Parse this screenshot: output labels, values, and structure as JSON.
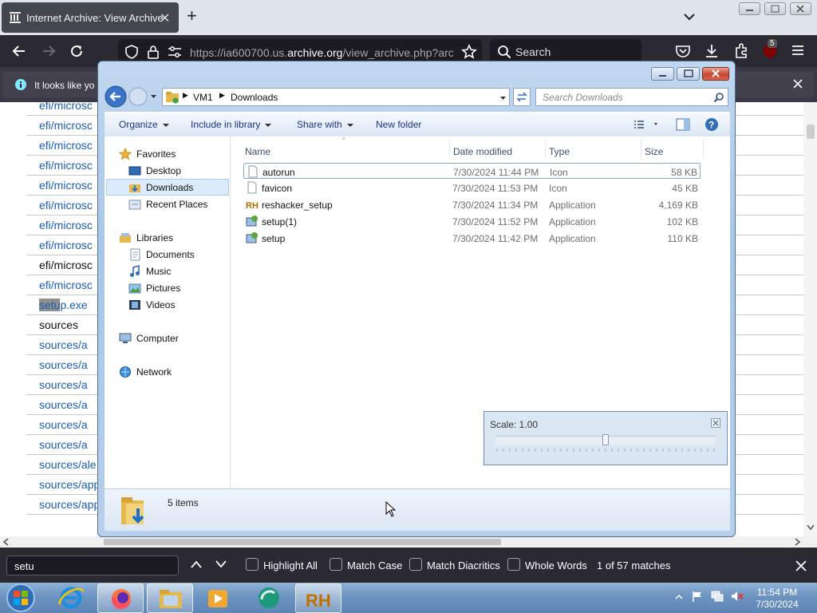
{
  "browser": {
    "tab_title": "Internet Archive: View Archive",
    "url_prefix": "https://ia600700.us.",
    "url_domain": "archive.org",
    "url_suffix": "/view_archive.php?archi",
    "search_placeholder": "Search",
    "extension_badge": "5",
    "notification_text": "It looks like yo"
  },
  "page": {
    "rows": [
      {
        "text": "efi/microsc",
        "plain": false
      },
      {
        "text": "efi/microsc",
        "plain": false
      },
      {
        "text": "efi/microsc",
        "plain": false
      },
      {
        "text": "efi/microsc",
        "plain": false
      },
      {
        "text": "efi/microsc",
        "plain": false
      },
      {
        "text": "efi/microsc",
        "plain": false
      },
      {
        "text": "efi/microsc",
        "plain": false
      },
      {
        "text": "efi/microsc",
        "plain": false
      },
      {
        "text": "efi/microsc",
        "plain": true
      },
      {
        "text": "efi/microsc",
        "plain": false
      },
      {
        "text": "p.exe",
        "highlight": "setu",
        "plain": false
      },
      {
        "text": "sources",
        "plain": true
      },
      {
        "text": "sources/a",
        "plain": false
      },
      {
        "text": "sources/a",
        "plain": false
      },
      {
        "text": "sources/a",
        "plain": false
      },
      {
        "text": "sources/a",
        "plain": false
      },
      {
        "text": "sources/a",
        "plain": false
      },
      {
        "text": "sources/a",
        "plain": false
      },
      {
        "text": "sources/ale",
        "plain": false
      },
      {
        "text": "sources/app",
        "plain": false
      },
      {
        "text": "sources/app",
        "plain": false
      }
    ]
  },
  "explorer": {
    "breadcrumb": [
      "VM1",
      "Downloads"
    ],
    "search_placeholder": "Search Downloads",
    "commands": {
      "organize": "Organize",
      "include": "Include in library",
      "share": "Share with",
      "new_folder": "New folder"
    },
    "nav": {
      "favorites": "Favorites",
      "desktop": "Desktop",
      "downloads": "Downloads",
      "recent": "Recent Places",
      "libraries": "Libraries",
      "documents": "Documents",
      "music": "Music",
      "pictures": "Pictures",
      "videos": "Videos",
      "computer": "Computer",
      "network": "Network"
    },
    "columns": {
      "name": "Name",
      "date": "Date modified",
      "type": "Type",
      "size": "Size"
    },
    "files": [
      {
        "name": "autorun",
        "date": "7/30/2024 11:44 PM",
        "type": "Icon",
        "size": "58 KB",
        "icon": "blank-file-icon"
      },
      {
        "name": "favicon",
        "date": "7/30/2024 11:53 PM",
        "type": "Icon",
        "size": "45 KB",
        "icon": "blank-file-icon"
      },
      {
        "name": "reshacker_setup",
        "date": "7/30/2024 11:34 PM",
        "type": "Application",
        "size": "4,169 KB",
        "icon": "reshacker-icon"
      },
      {
        "name": "setup(1)",
        "date": "7/30/2024 11:52 PM",
        "type": "Application",
        "size": "102 KB",
        "icon": "setup-app-icon"
      },
      {
        "name": "setup",
        "date": "7/30/2024 11:42 PM",
        "type": "Application",
        "size": "110 KB",
        "icon": "setup-app-icon"
      }
    ],
    "status_text": "5 items",
    "scale_label": "Scale: 1.00",
    "scale_value": 1.0
  },
  "findbar": {
    "query": "setu",
    "highlight_all": "Highlight All",
    "match_case": "Match Case",
    "match_diacritics": "Match Diacritics",
    "whole_words": "Whole Words",
    "result": "1 of 57 matches"
  },
  "taskbar": {
    "apps": [
      "start-orb",
      "internet-explorer",
      "firefox",
      "windows-explorer",
      "media-player",
      "app-5",
      "resource-hacker"
    ],
    "time": "11:54 PM",
    "date": "7/30/2024"
  },
  "colors": {
    "link": "#1a5db4",
    "browser_dark": "#2b2a33",
    "taskbar": "#6d93c0"
  }
}
